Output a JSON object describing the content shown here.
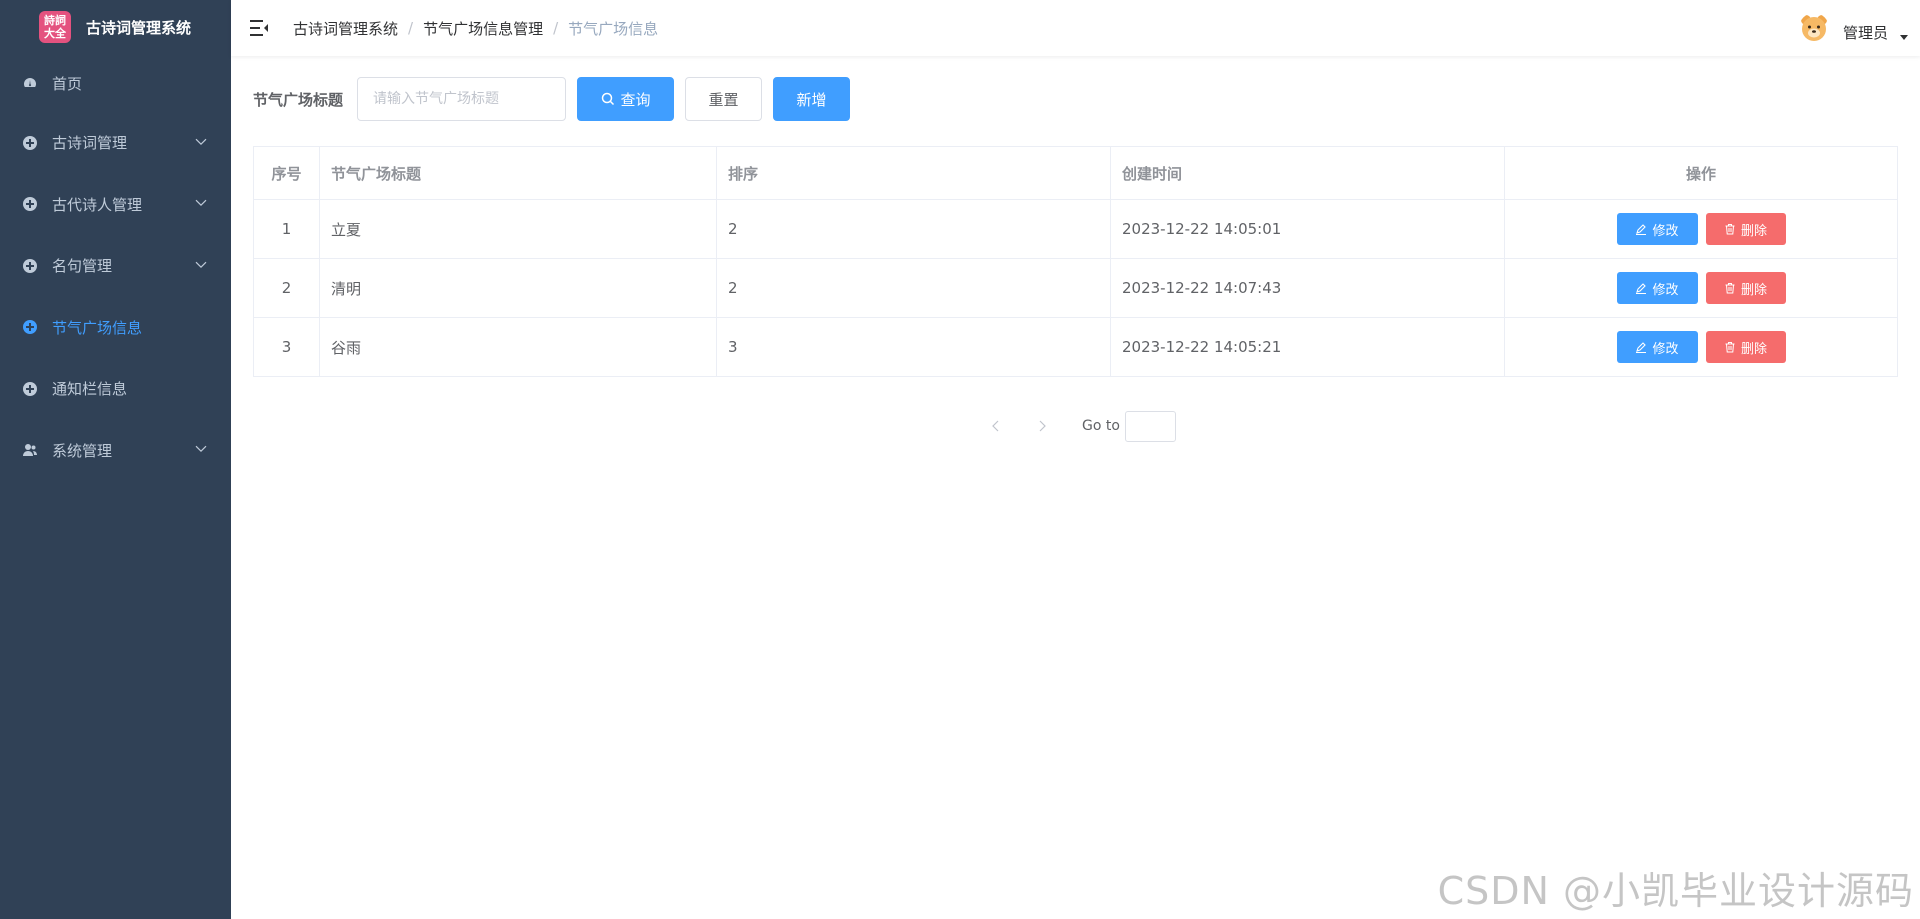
{
  "app": {
    "title": "古诗词管理系统",
    "logo_line1": "詩詞",
    "logo_line2": "大全"
  },
  "sidebar": {
    "items": [
      {
        "label": "首页",
        "icon": "dashboard-icon"
      },
      {
        "label": "古诗词管理",
        "icon": "circle-icon",
        "expandable": true
      },
      {
        "label": "古代诗人管理",
        "icon": "circle-icon",
        "expandable": true
      },
      {
        "label": "名句管理",
        "icon": "circle-icon",
        "expandable": true
      },
      {
        "label": "节气广场信息",
        "icon": "circle-icon",
        "active": true
      },
      {
        "label": "通知栏信息",
        "icon": "circle-icon"
      },
      {
        "label": "系统管理",
        "icon": "user-group-icon",
        "expandable": true
      }
    ]
  },
  "header": {
    "breadcrumb": [
      "古诗词管理系统",
      "节气广场信息管理",
      "节气广场信息"
    ],
    "user_name": "管理员"
  },
  "search": {
    "label": "节气广场标题",
    "placeholder": "请输入节气广场标题",
    "query_label": "查询",
    "reset_label": "重置",
    "add_label": "新增"
  },
  "table": {
    "columns": [
      "序号",
      "节气广场标题",
      "排序",
      "创建时间",
      "操作"
    ],
    "rows": [
      {
        "idx": "1",
        "title": "立夏",
        "sort": "2",
        "time": "2023-12-22 14:05:01"
      },
      {
        "idx": "2",
        "title": "清明",
        "sort": "2",
        "time": "2023-12-22 14:07:43"
      },
      {
        "idx": "3",
        "title": "谷雨",
        "sort": "3",
        "time": "2023-12-22 14:05:21"
      }
    ],
    "edit_label": "修改",
    "delete_label": "删除"
  },
  "pagination": {
    "goto_label": "Go to"
  },
  "watermark": "CSDN @小凯毕业设计源码",
  "colors": {
    "sidebar_bg": "#304156",
    "primary": "#409eff",
    "danger": "#f56c6c",
    "active_menu": "#409eff"
  }
}
